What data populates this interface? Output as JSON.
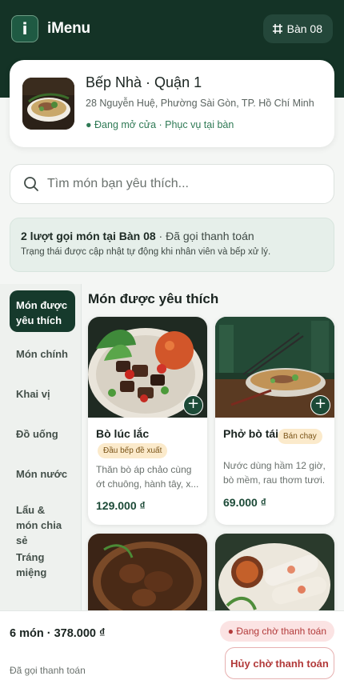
{
  "header": {
    "app_name": "iMenu",
    "logo_letter": "i",
    "table_label": "Bàn 08"
  },
  "restaurant": {
    "name": "Bếp Nhà · Quận 1",
    "address": "28 Nguyễn Huệ, Phường Sài Gòn, TP. Hồ Chí Minh",
    "status": "● Đang mở cửa · Phục vụ tại bàn"
  },
  "search": {
    "placeholder": "Tìm món bạn yêu thích..."
  },
  "order_banner": {
    "title_bold": "2 lượt gọi món tại Bàn 08",
    "title_rest": " · Đã gọi thanh toán",
    "note": "Trạng thái được cập nhật tự động khi nhân viên và bếp xử lý."
  },
  "categories": [
    {
      "label": "Món được yêu thích",
      "active": true
    },
    {
      "label": "Món chính",
      "active": false
    },
    {
      "label": "Khai vị",
      "active": false
    },
    {
      "label": "Đồ uống",
      "active": false
    },
    {
      "label": "Món nước",
      "active": false
    },
    {
      "label": "Lẩu & món chia sẻ",
      "active": false
    },
    {
      "label": "Tráng miệng",
      "active": false
    }
  ],
  "section_title": "Món được yêu thích",
  "dishes": [
    {
      "name": "Bò lúc lắc",
      "tag": "Đầu bếp đề xuất",
      "description": "Thăn bò áp chảo cùng ớt chuông, hành tây, x...",
      "price": "129.000 ₫"
    },
    {
      "name": "Phở bò tái",
      "tag": "Bán chạy",
      "description": "Nước dùng hầm 12 giờ, bò mềm, rau thơm tươi.",
      "price": "69.000 ₫"
    }
  ],
  "add_symbol": "+",
  "footer": {
    "summary": "6 món · 378.000 ₫",
    "sub": "Đã gọi thanh toán",
    "pending_badge": "● Đang chờ thanh toán",
    "cancel_label": "Hủy chờ thanh toán"
  },
  "colors": {
    "header_bg": "#143326",
    "accent": "#1c4a37",
    "status_green": "#2f7a55",
    "pending_red": "#b23a3a",
    "tag_bg": "#fbeacb"
  }
}
